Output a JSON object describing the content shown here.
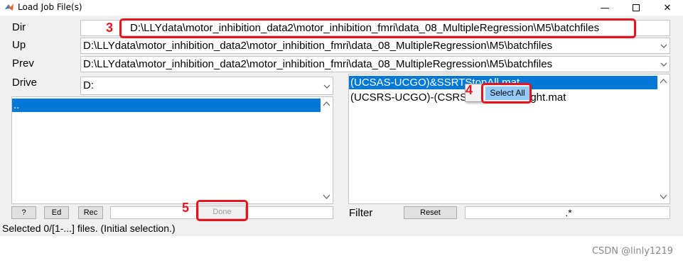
{
  "window": {
    "title": "Load Job File(s)"
  },
  "labels": {
    "dir": "Dir",
    "up": "Up",
    "prev": "Prev",
    "drive": "Drive",
    "filter": "Filter"
  },
  "dir_value": "D:\\LLYdata\\motor_inhibition_data2\\motor_inhibition_fmri\\data_08_MultipleRegression\\M5\\batchfiles",
  "up_value": "D:\\LLYdata\\motor_inhibition_data2\\motor_inhibition_fmri\\data_08_MultipleRegression\\M5\\batchfiles",
  "prev_value": "D:\\LLYdata\\motor_inhibition_data2\\motor_inhibition_fmri\\data_08_MultipleRegression\\M5\\batchfiles",
  "drive_value": "D:",
  "dir_list": [
    ".."
  ],
  "file_list": [
    "(UCSAS-UCGO)&SSRTStopAll.mat",
    "(UCSRS-UCGO)-(CSRS-CGO)StopRight.mat"
  ],
  "buttons": {
    "help": "?",
    "ed": "Ed",
    "rec": "Rec",
    "done": "Done",
    "reset": "Reset"
  },
  "filter_value": ".*",
  "context_menu": {
    "select_all": "Select All"
  },
  "status": "Selected 0/[1-...] files. (Initial selection.)",
  "annotations": {
    "n3": "3",
    "n4": "4",
    "n5": "5"
  },
  "watermark": "CSDN @linly1219",
  "colors": {
    "selection": "#0078d7",
    "annotation": "#e8131f",
    "menu_highlight": "#91c9f7"
  }
}
